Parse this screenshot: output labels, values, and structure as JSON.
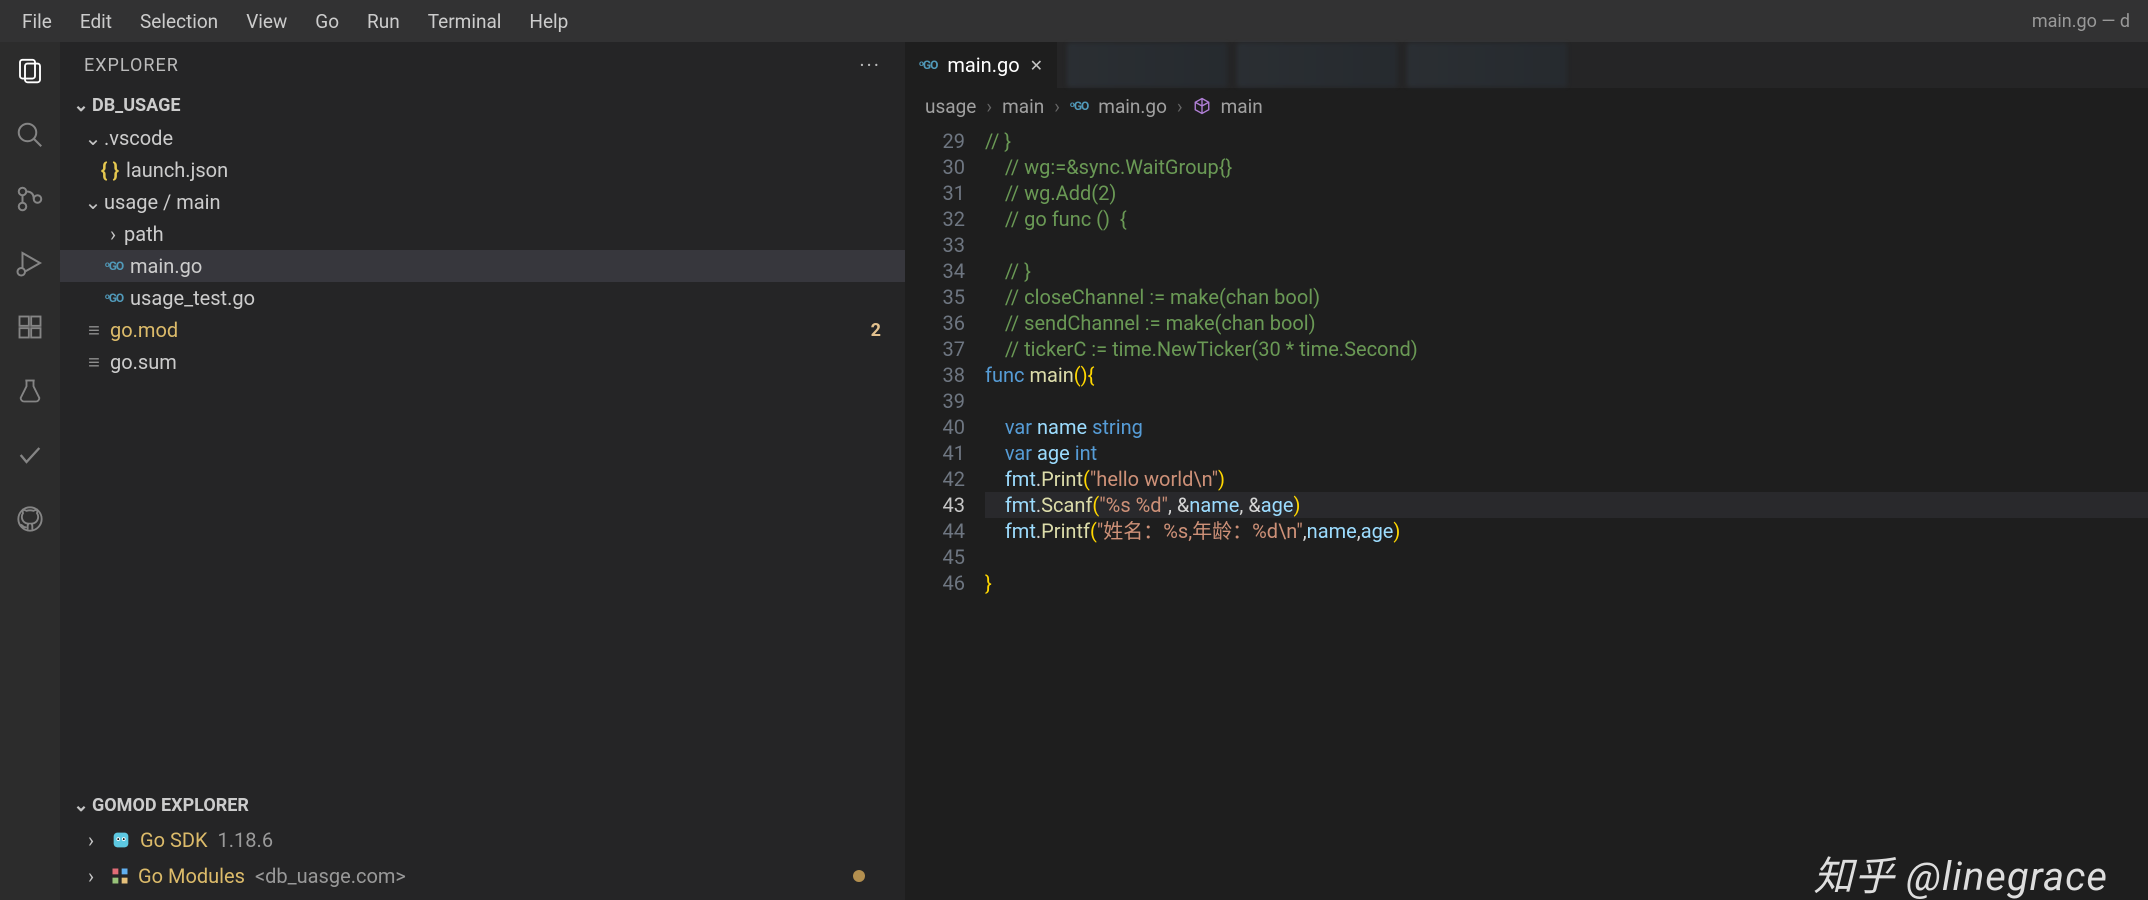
{
  "menubar": {
    "items": [
      "File",
      "Edit",
      "Selection",
      "View",
      "Go",
      "Run",
      "Terminal",
      "Help"
    ],
    "title": "main.go — d"
  },
  "sidebar": {
    "title": "EXPLORER",
    "project": "DB_USAGE",
    "tree": [
      {
        "type": "folder",
        "name": ".vscode",
        "indent": 22,
        "open": true
      },
      {
        "type": "file",
        "name": "launch.json",
        "indent": 38,
        "icon": "braces"
      },
      {
        "type": "folder",
        "name": "usage / main",
        "indent": 22,
        "open": true
      },
      {
        "type": "folder",
        "name": "path",
        "indent": 42,
        "open": false
      },
      {
        "type": "file",
        "name": "main.go",
        "indent": 42,
        "icon": "go",
        "selected": true
      },
      {
        "type": "file",
        "name": "usage_test.go",
        "indent": 42,
        "icon": "go"
      },
      {
        "type": "file",
        "name": "go.mod",
        "indent": 22,
        "icon": "lines",
        "mod": true,
        "badge": "2"
      },
      {
        "type": "file",
        "name": "go.sum",
        "indent": 22,
        "icon": "lines"
      }
    ],
    "gomod": {
      "title": "GOMOD EXPLORER",
      "sdk": {
        "label": "Go SDK",
        "version": "1.18.6"
      },
      "modules": {
        "label": "Go Modules",
        "scope": "<db_uasge.com>"
      }
    }
  },
  "tabs": {
    "active": {
      "lang": "GO",
      "name": "main.go"
    }
  },
  "breadcrumbs": [
    "usage",
    "main",
    "main.go",
    "main"
  ],
  "code": {
    "start": 29,
    "current": 43,
    "lines": [
      {
        "n": 29,
        "t": "comment",
        "txt": "// }"
      },
      {
        "n": 30,
        "t": "comment",
        "txt": "    // wg:=&sync.WaitGroup{}"
      },
      {
        "n": 31,
        "t": "comment",
        "txt": "    // wg.Add(2)"
      },
      {
        "n": 32,
        "t": "comment",
        "txt": "    // go func ()  {"
      },
      {
        "n": 33,
        "t": "blank",
        "txt": ""
      },
      {
        "n": 34,
        "t": "comment",
        "txt": "    // }"
      },
      {
        "n": 35,
        "t": "comment",
        "txt": "    // closeChannel := make(chan bool)"
      },
      {
        "n": 36,
        "t": "comment",
        "txt": "    // sendChannel := make(chan bool)"
      },
      {
        "n": 37,
        "t": "comment",
        "txt": "    // tickerC := time.NewTicker(30 * time.Second)"
      },
      {
        "n": 38,
        "t": "funcdecl",
        "txt": "func main(){"
      },
      {
        "n": 39,
        "t": "blank",
        "txt": ""
      },
      {
        "n": 40,
        "t": "var",
        "txt": "    var name string"
      },
      {
        "n": 41,
        "t": "var",
        "txt": "    var age int"
      },
      {
        "n": 42,
        "t": "call",
        "txt": "    fmt.Print(\"hello world\\n\")"
      },
      {
        "n": 43,
        "t": "call",
        "txt": "    fmt.Scanf(\"%s %d\", &name, &age)"
      },
      {
        "n": 44,
        "t": "call",
        "txt": "    fmt.Printf(\"姓名：%s,年龄：%d\\n\",name,age)"
      },
      {
        "n": 45,
        "t": "blank",
        "txt": ""
      },
      {
        "n": 46,
        "t": "brace",
        "txt": "}"
      }
    ]
  },
  "watermark": "知乎 @linegrace"
}
